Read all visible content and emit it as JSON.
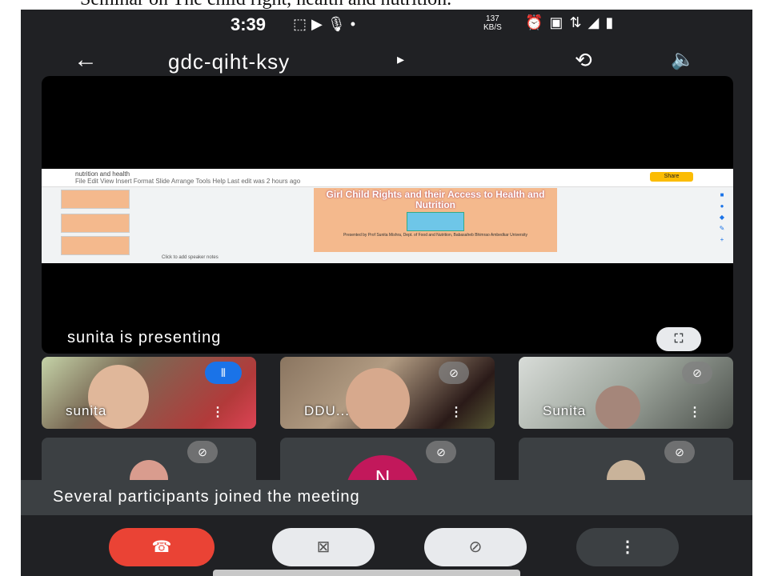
{
  "caption": "Seminar on The child right, health and nutrition.",
  "status_bar": {
    "time": "3:39",
    "net_speed": "137",
    "net_unit": "KB/S",
    "icons": [
      "screen-record-icon",
      "youtube-icon",
      "mic-icon",
      "dot-icon",
      "alarm-icon",
      "volte-icon",
      "4g-signal-icon",
      "signal-icon",
      "battery-icon"
    ]
  },
  "header": {
    "meeting_code": "gdc-qiht-ksy",
    "icons": [
      "back-arrow-icon",
      "caret-right-icon",
      "switch-camera-icon",
      "speaker-icon"
    ]
  },
  "presentation": {
    "presenting_text": "sunita is presenting",
    "doc_title": "nutrition and health",
    "doc_menu": "File  Edit  View  Insert  Format  Slide  Arrange  Tools  Help   Last edit was 2 hours ago",
    "share_label": "Share",
    "slide_title": "Girl Child Rights and their Access to Health and Nutrition",
    "slide_byline": "Presented by Prof Sunita Mishra, Dept. of Food and Nutrition, Babasaheb Bhimrao Ambedkar University",
    "notes_placeholder": "Click to add speaker notes",
    "fullscreen_icon": "fullscreen-icon"
  },
  "participants": [
    {
      "name": "sunita",
      "status": "speaking"
    },
    {
      "name": "DDU...",
      "status": "muted"
    },
    {
      "name": "Sunita",
      "status": "muted"
    }
  ],
  "participants_row2": [
    {
      "type": "photo",
      "status": "muted"
    },
    {
      "type": "initial",
      "initial": "N",
      "status": "muted"
    },
    {
      "type": "photo",
      "status": "muted"
    }
  ],
  "toast": {
    "message": "Several participants joined the meeting"
  },
  "controls": {
    "hangup_icon": "phone-hangup-icon",
    "camera_icon": "camera-off-icon",
    "mic_icon": "mic-off-icon",
    "more_icon": "more-vertical-icon"
  },
  "colors": {
    "background": "#202124",
    "hangup": "#ea4335",
    "speaking": "#1a73e8",
    "initial_avatar": "#c2185b",
    "slide_bg": "#f4b98d"
  }
}
